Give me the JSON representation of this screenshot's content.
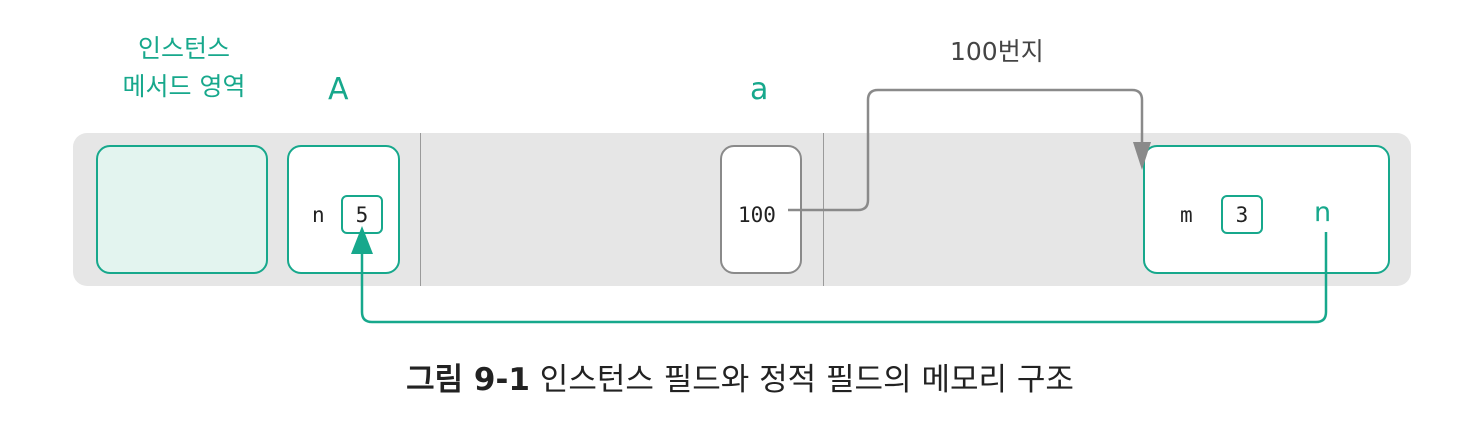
{
  "labels": {
    "method_area_line1": "인스턴스",
    "method_area_line2": "메서드 영역",
    "class_a": "A",
    "var_a": "a",
    "address": "100번지"
  },
  "class_area": {
    "field_name": "n",
    "field_value": "5"
  },
  "stack": {
    "value": "100"
  },
  "heap_object": {
    "field_m_name": "m",
    "field_m_value": "3",
    "field_n_name": "n"
  },
  "caption": {
    "number": "그림 9-1",
    "text": "인스턴스 필드와 정적 필드의 메모리 구조"
  },
  "colors": {
    "accent": "#17a88c",
    "gray_line": "#8a8a8a",
    "strip": "#e6e6e6",
    "method_box_fill": "#e3f4ef"
  }
}
